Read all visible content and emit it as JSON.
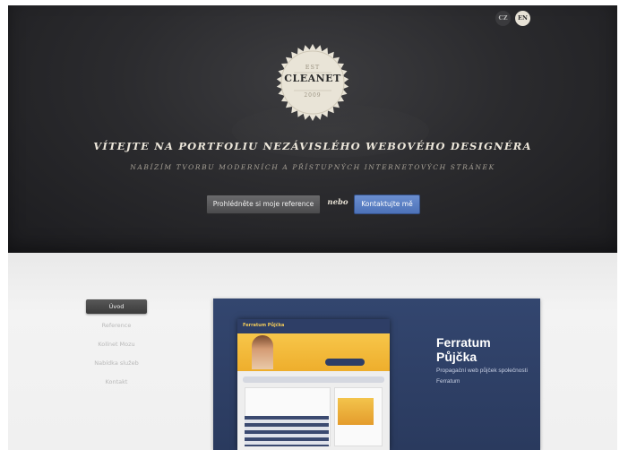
{
  "header": {
    "languages": [
      {
        "label": "CZ",
        "active": false
      },
      {
        "label": "EN",
        "active": true
      }
    ],
    "badge": {
      "est": "EST",
      "name": "CLEANET",
      "year": "2009"
    },
    "headline": "VÍTEJTE NA PORTFOLIU NEZÁVISLÉHO WEBOVÉHO DESIGNÉRA",
    "subheadline": "NABÍZÍM TVORBU MODERNÍCH A PŘÍSTUPNÝCH INTERNETOVÝCH STRÁNEK",
    "buttons": {
      "references": "Prohlédněte si moje reference",
      "or": "nebo",
      "contact": "Kontaktujte mě"
    }
  },
  "sidebar": {
    "items": [
      {
        "label": "Úvod",
        "active": true
      },
      {
        "label": "Reference",
        "active": false
      },
      {
        "label": "Kolínet Mozu",
        "active": false
      },
      {
        "label": "Nabídka služeb",
        "active": false
      },
      {
        "label": "Kontakt",
        "active": false
      }
    ]
  },
  "project": {
    "title": "Ferratum Půjčka",
    "description": "Propagační web půjček společnosti Ferratum",
    "screenshot_header": "Ferratum Půjčka",
    "colors": {
      "card": "#2f4168",
      "accent": "#f2b83a",
      "contact_button": "#5a7fc4"
    }
  }
}
